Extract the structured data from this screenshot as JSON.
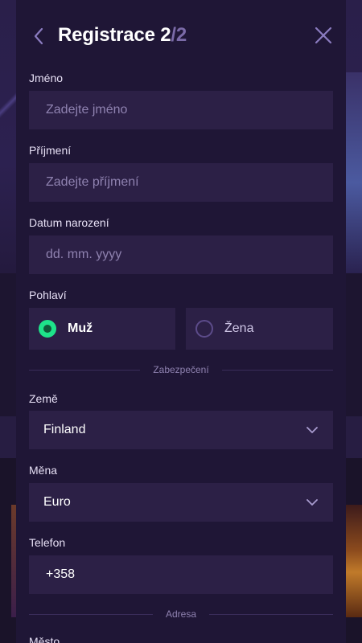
{
  "header": {
    "title": "Registrace 2",
    "step_total": "/2"
  },
  "fields": {
    "first_name": {
      "label": "Jméno",
      "placeholder": "Zadejte jméno"
    },
    "last_name": {
      "label": "Příjmení",
      "placeholder": "Zadejte příjmení"
    },
    "birth_date": {
      "label": "Datum narození",
      "placeholder": "dd. mm. yyyy"
    },
    "gender": {
      "label": "Pohlaví",
      "options": [
        "Muž",
        "Žena"
      ],
      "selected": "Muž"
    }
  },
  "sections": {
    "security": "Zabezpečení",
    "address": "Adresa"
  },
  "security": {
    "country": {
      "label": "Země",
      "value": "Finland"
    },
    "currency": {
      "label": "Měna",
      "value": "Euro"
    },
    "phone": {
      "label": "Telefon",
      "value": "+358"
    }
  },
  "address": {
    "city": {
      "label": "Město"
    }
  },
  "colors": {
    "accent": "#1ee38a",
    "modal_bg": "#1f1636",
    "input_bg": "#2c2046"
  }
}
